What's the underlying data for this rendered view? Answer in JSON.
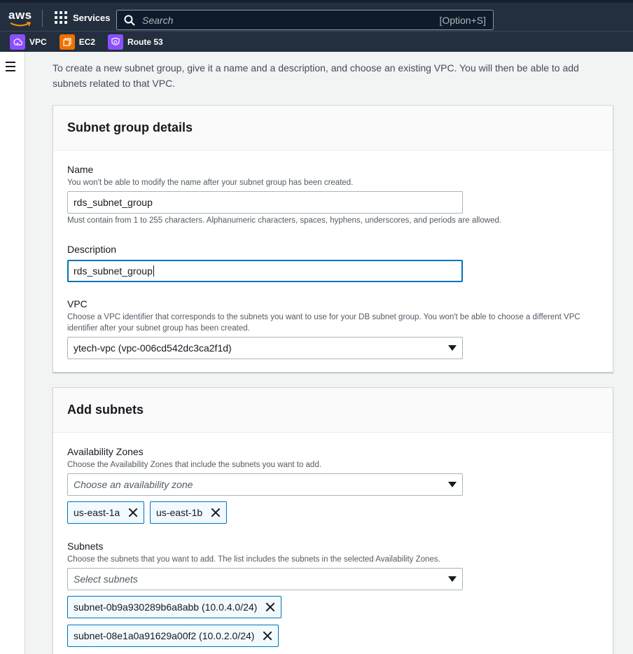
{
  "topbar": {
    "logo_text": "aws",
    "services_label": "Services",
    "search_placeholder": "Search",
    "search_shortcut": "[Option+S]"
  },
  "favorites": [
    {
      "label": "VPC",
      "icon": "vpc-icon",
      "color": "#8c4fff"
    },
    {
      "label": "EC2",
      "icon": "ec2-icon",
      "color": "#ed7100"
    },
    {
      "label": "Route 53",
      "icon": "route53-icon",
      "color": "#8c4fff"
    }
  ],
  "page": {
    "intro": "To create a new subnet group, give it a name and a description, and choose an existing VPC. You will then be able to add subnets related to that VPC."
  },
  "details": {
    "title": "Subnet group details",
    "name_label": "Name",
    "name_desc": "You won't be able to modify the name after your subnet group has been created.",
    "name_value": "rds_subnet_group",
    "name_constraint": "Must contain from 1 to 255 characters. Alphanumeric characters, spaces, hyphens, underscores, and periods are allowed.",
    "description_label": "Description",
    "description_value": "rds_subnet_group",
    "vpc_label": "VPC",
    "vpc_desc": "Choose a VPC identifier that corresponds to the subnets you want to use for your DB subnet group. You won't be able to choose a different VPC identifier after your subnet group has been created.",
    "vpc_value": "ytech-vpc (vpc-006cd542dc3ca2f1d)"
  },
  "subnets_panel": {
    "title": "Add subnets",
    "az_label": "Availability Zones",
    "az_desc": "Choose the Availability Zones that include the subnets you want to add.",
    "az_placeholder": "Choose an availability zone",
    "az_tokens": [
      "us-east-1a",
      "us-east-1b"
    ],
    "subnets_label": "Subnets",
    "subnets_desc": "Choose the subnets that you want to add. The list includes the subnets in the selected Availability Zones.",
    "subnets_placeholder": "Select subnets",
    "subnet_tokens": [
      "subnet-0b9a930289b6a8abb (10.0.4.0/24)",
      "subnet-08e1a0a91629a00f2 (10.0.2.0/24)"
    ]
  },
  "colors": {
    "nav_bg": "#232f3e",
    "accent": "#0073bb",
    "token_bg": "#f1faff"
  }
}
